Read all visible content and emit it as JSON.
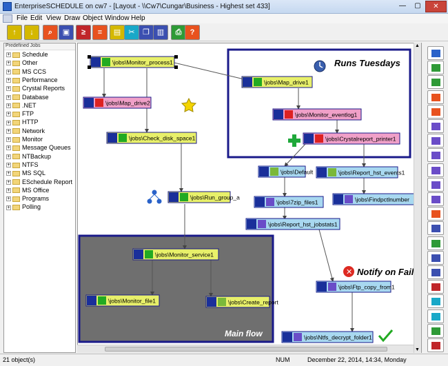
{
  "window": {
    "title": "EnterpriseSCHEDULE on cw7 - [Layout - \\\\Cw7\\Cungar\\Business - Highest set 433]",
    "min_label": "—",
    "max_label": "▢",
    "close_label": "✕"
  },
  "menu": {
    "items": [
      "File",
      "Edit",
      "View",
      "Draw",
      "Object",
      "Window",
      "Help"
    ]
  },
  "toolbar": {
    "buttons": [
      {
        "name": "open-layout",
        "glyph": "↑",
        "color": "#d4b800"
      },
      {
        "name": "save-layout",
        "glyph": "↓",
        "color": "#d4b800"
      },
      {
        "name": "find",
        "glyph": "⌕",
        "color": "#e8521e"
      },
      {
        "name": "monitor",
        "glyph": "▣",
        "color": "#3b4fb0"
      },
      {
        "name": "console",
        "glyph": "≥",
        "color": "#c0262a"
      },
      {
        "name": "report",
        "glyph": "≡",
        "color": "#e8521e"
      },
      {
        "name": "schedule",
        "glyph": "▤",
        "color": "#d4b800"
      },
      {
        "name": "cut",
        "glyph": "✂",
        "color": "#19a8c8"
      },
      {
        "name": "copy",
        "glyph": "❐",
        "color": "#3b4fb0"
      },
      {
        "name": "paste",
        "glyph": "▥",
        "color": "#3b4fb0"
      },
      {
        "name": "print",
        "glyph": "⎙",
        "color": "#2e9a36"
      },
      {
        "name": "help",
        "glyph": "?",
        "color": "#e8521e"
      }
    ]
  },
  "tree": {
    "header": "Predefined Jobs",
    "items": [
      "Schedule",
      "Other",
      "MS CCS",
      "Performance",
      "Crystal Reports",
      "Database",
      ".NET",
      "FTP",
      "HTTP",
      "Network",
      "Monitor",
      "Message Queues",
      "NTBackup",
      "NTFS",
      "MS SQL",
      "ESchedule Report",
      "MS Office",
      "Programs",
      "Polling"
    ]
  },
  "canvas": {
    "groups": [
      {
        "name": "runs-tuesdays",
        "label": "Runs Tuesdays"
      },
      {
        "name": "main-flow",
        "label": "Main flow"
      }
    ],
    "annotations": {
      "notify": "Notify on Fail"
    },
    "jobs": [
      {
        "id": "monitor_process1",
        "label": "\\jobs\\Monitor_process1",
        "status": "ok",
        "fill": "#e8f06a"
      },
      {
        "id": "map_drive1",
        "label": "\\jobs\\Map_drive1",
        "status": "ok",
        "fill": "#e8f06a"
      },
      {
        "id": "map_drive2",
        "label": "\\jobs\\Map_drive2",
        "status": "fail",
        "fill": "#f0a0c8"
      },
      {
        "id": "monitor_eventlog1",
        "label": "\\jobs\\Monitor_eventlog1",
        "status": "fail",
        "fill": "#f0a0c8"
      },
      {
        "id": "check_disk_space1",
        "label": "\\jobs\\Check_disk_space1",
        "status": "ok",
        "fill": "#e8f06a"
      },
      {
        "id": "crystalreport_printer1",
        "label": "\\jobs\\Crystalreport_printer1",
        "status": "fail",
        "fill": "#f0a0c8"
      },
      {
        "id": "default",
        "label": "\\jobs\\Default",
        "status": "pending",
        "fill": "#a8d8f0"
      },
      {
        "id": "report_hst_events1",
        "label": "\\jobs\\Report_hst_events1",
        "status": "pending",
        "fill": "#a8d8f0"
      },
      {
        "id": "run_group_a",
        "label": "\\jobs\\Run_group_a",
        "status": "ok",
        "fill": "#e8f06a"
      },
      {
        "id": "zip_files1",
        "label": "\\jobs\\7zip_files1",
        "status": "queued",
        "fill": "#a8d8f0"
      },
      {
        "id": "findpctlnumber",
        "label": "\\jobs\\Findpctlnumber",
        "status": "queued",
        "fill": "#a8d8f0"
      },
      {
        "id": "report_hst_jobstats1",
        "label": "\\jobs\\Report_hst_jobstats1",
        "status": "queued",
        "fill": "#a8d8f0"
      },
      {
        "id": "monitor_service1",
        "label": "\\jobs\\Monitor_service1",
        "status": "ok",
        "fill": "#e8f06a"
      },
      {
        "id": "ftp_copy_from1",
        "label": "\\jobs\\Ftp_copy_from1",
        "status": "queued",
        "fill": "#a8d8f0"
      },
      {
        "id": "monitor_file1",
        "label": "\\jobs\\Monitor_file1",
        "status": "ok",
        "fill": "#e8f06a"
      },
      {
        "id": "create_report",
        "label": "\\jobs\\Create_report",
        "status": "pending",
        "fill": "#e8f06a"
      },
      {
        "id": "ntfs_decrypt_folder1",
        "label": "\\jobs\\Ntfs_decrypt_folder1",
        "status": "queued",
        "fill": "#a8d8f0"
      }
    ]
  },
  "palette": {
    "tools": [
      "pointer",
      "add-job",
      "add-group",
      "add-report",
      "add-console",
      "line",
      "rectangle",
      "rounded-rect",
      "ellipse",
      "triangle",
      "text",
      "link",
      "list",
      "run",
      "program",
      "monitor",
      "chart",
      "clock",
      "clock2",
      "timer",
      "calendar"
    ]
  },
  "status": {
    "objects": "21 object(s)",
    "num": "NUM",
    "datetime": "December 22, 2014, 14:34, Monday"
  },
  "colors": {
    "group_border": "#1a1a8a",
    "main_flow_fill": "#6f6f6f",
    "ok": "#22aa22",
    "fail": "#dd2222",
    "pending": "#7ab83a",
    "queued": "#6a4cc8"
  }
}
